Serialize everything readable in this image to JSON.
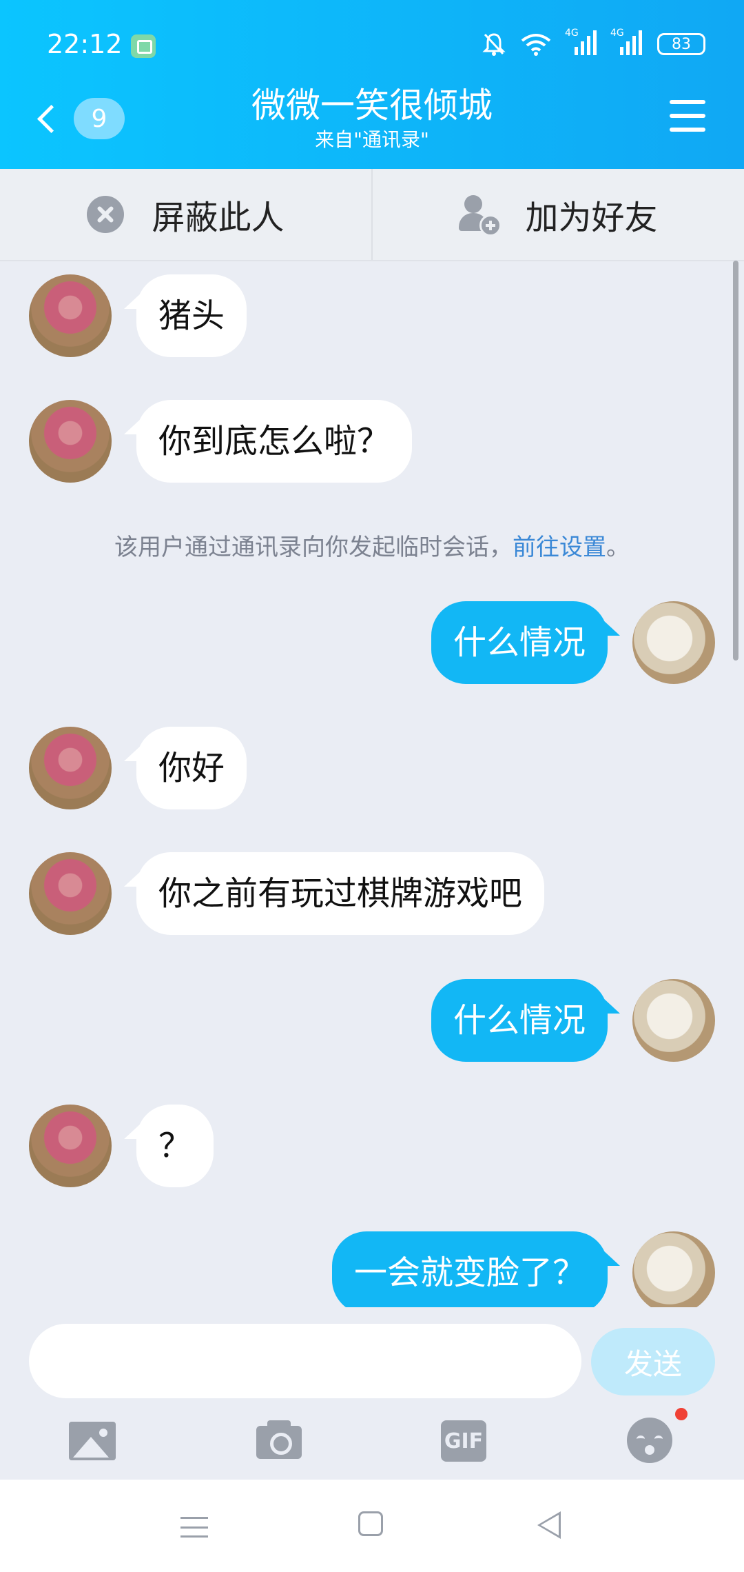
{
  "status_bar": {
    "time": "22:12",
    "network_1": "4G",
    "network_2": "4G",
    "battery": "83"
  },
  "header": {
    "unread_count": "9",
    "title": "微微一笑很倾城",
    "subtitle": "来自\"通讯录\""
  },
  "actions": {
    "block_label": "屏蔽此人",
    "add_friend_label": "加为好友"
  },
  "messages": [
    {
      "from": "other",
      "text": "猪头"
    },
    {
      "from": "other",
      "text": "你到底怎么啦？"
    },
    {
      "from": "me",
      "text": "什么情况"
    },
    {
      "from": "other",
      "text": "你好"
    },
    {
      "from": "other",
      "text": "你之前有玩过棋牌游戏吧"
    },
    {
      "from": "me",
      "text": "什么情况"
    },
    {
      "from": "other",
      "text": "？"
    },
    {
      "from": "me",
      "text": "一会就变脸了？"
    }
  ],
  "notice": {
    "text": "该用户通过通讯录向你发起临时会话，",
    "link": "前往设置",
    "end": "。"
  },
  "input": {
    "value": "",
    "send_label": "发送"
  },
  "toolbar": {
    "gif_label": "GIF"
  },
  "colors": {
    "header_gradient_start": "#0bc5ff",
    "header_gradient_end": "#10a8f4",
    "outgoing_bubble": "#12b7f5",
    "link": "#3a88d6",
    "badge_dot": "#f04135"
  }
}
